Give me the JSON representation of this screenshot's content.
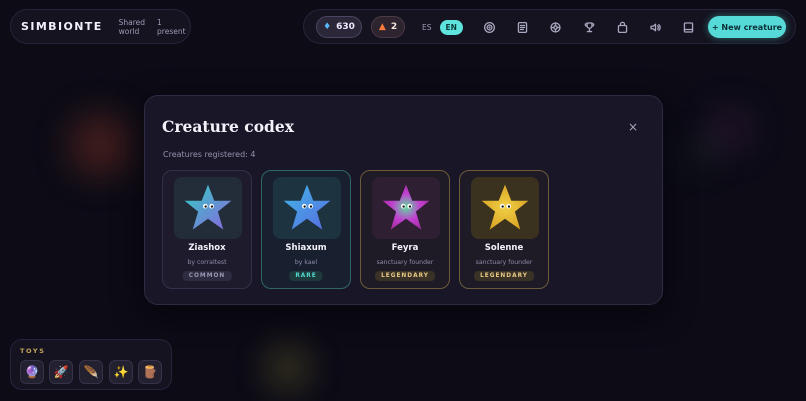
{
  "brand": {
    "name": "SIMBIONTE",
    "world": "Shared world",
    "present": "1 present"
  },
  "toolbar": {
    "gems": "630",
    "fire": "2",
    "lang_es": "ES",
    "lang_en": "EN",
    "icons": [
      "target-icon",
      "journal-icon",
      "settings-icon",
      "trophy-icon",
      "bag-icon",
      "volume-icon",
      "book-icon"
    ],
    "new_creature": "+ New creature"
  },
  "modal": {
    "title": "Creature codex",
    "close": "×",
    "count": "Creatures registered: 4",
    "creatures": [
      {
        "name": "Ziashox",
        "by": "by corraltest",
        "rarity": "COMMON",
        "colors": [
          "#2ed0c2",
          "#8d63e0"
        ]
      },
      {
        "name": "Shiaxum",
        "by": "by kael",
        "rarity": "RARE",
        "colors": [
          "#3fb8e8",
          "#5a6be0"
        ]
      },
      {
        "name": "Feyra",
        "by": "sanctuary founder",
        "rarity": "LEGENDARY",
        "colors": [
          "#c23fd0",
          "#5fdca0"
        ]
      },
      {
        "name": "Solenne",
        "by": "sanctuary founder",
        "rarity": "LEGENDARY",
        "colors": [
          "#e6b52a",
          "#f1d045"
        ]
      }
    ]
  },
  "toys": {
    "label": "TOYS",
    "items": [
      "🔮",
      "🚀",
      "🪶",
      "✨",
      "🪵"
    ]
  },
  "colors": {
    "accent": "#56dad7",
    "gold": "#c7a55e",
    "background": "#0c0b16"
  }
}
